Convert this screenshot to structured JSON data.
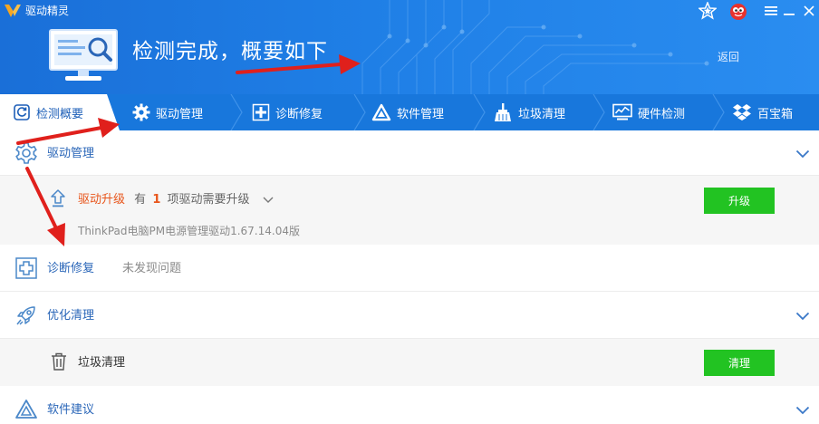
{
  "titlebar": {
    "app_title": "驱动精灵"
  },
  "hero": {
    "title": "检测完成，概要如下",
    "back_label": "返回"
  },
  "tabs": [
    {
      "label": "检测概要",
      "icon": "refresh-icon",
      "active": true
    },
    {
      "label": "驱动管理",
      "icon": "gear-icon"
    },
    {
      "label": "诊断修复",
      "icon": "medical-cross-icon"
    },
    {
      "label": "软件管理",
      "icon": "triangle-logo-icon"
    },
    {
      "label": "垃圾清理",
      "icon": "broom-icon"
    },
    {
      "label": "硬件检测",
      "icon": "monitor-chart-icon"
    },
    {
      "label": "百宝箱",
      "icon": "dropbox-icon"
    }
  ],
  "sections": {
    "driver": {
      "title": "驱动管理",
      "upgrade_label": "驱动升级",
      "upgrade_prefix": "有",
      "upgrade_count": "1",
      "upgrade_suffix": "项驱动需要升级",
      "driver_name": "ThinkPad电脑PM电源管理驱动1.67.14.04版",
      "upgrade_button": "升级"
    },
    "diagnose": {
      "title": "诊断修复",
      "status": "未发现问题"
    },
    "optimize": {
      "title": "优化清理",
      "junk_label": "垃圾清理",
      "clean_button": "清理"
    },
    "software": {
      "title": "软件建议"
    }
  },
  "colors": {
    "header_blue": "#1a6fd8",
    "tab_blue": "#1877dc",
    "accent_blue": "#2a66b8",
    "orange": "#e8561c",
    "green": "#22c322",
    "annotation_red": "#e0201c"
  }
}
